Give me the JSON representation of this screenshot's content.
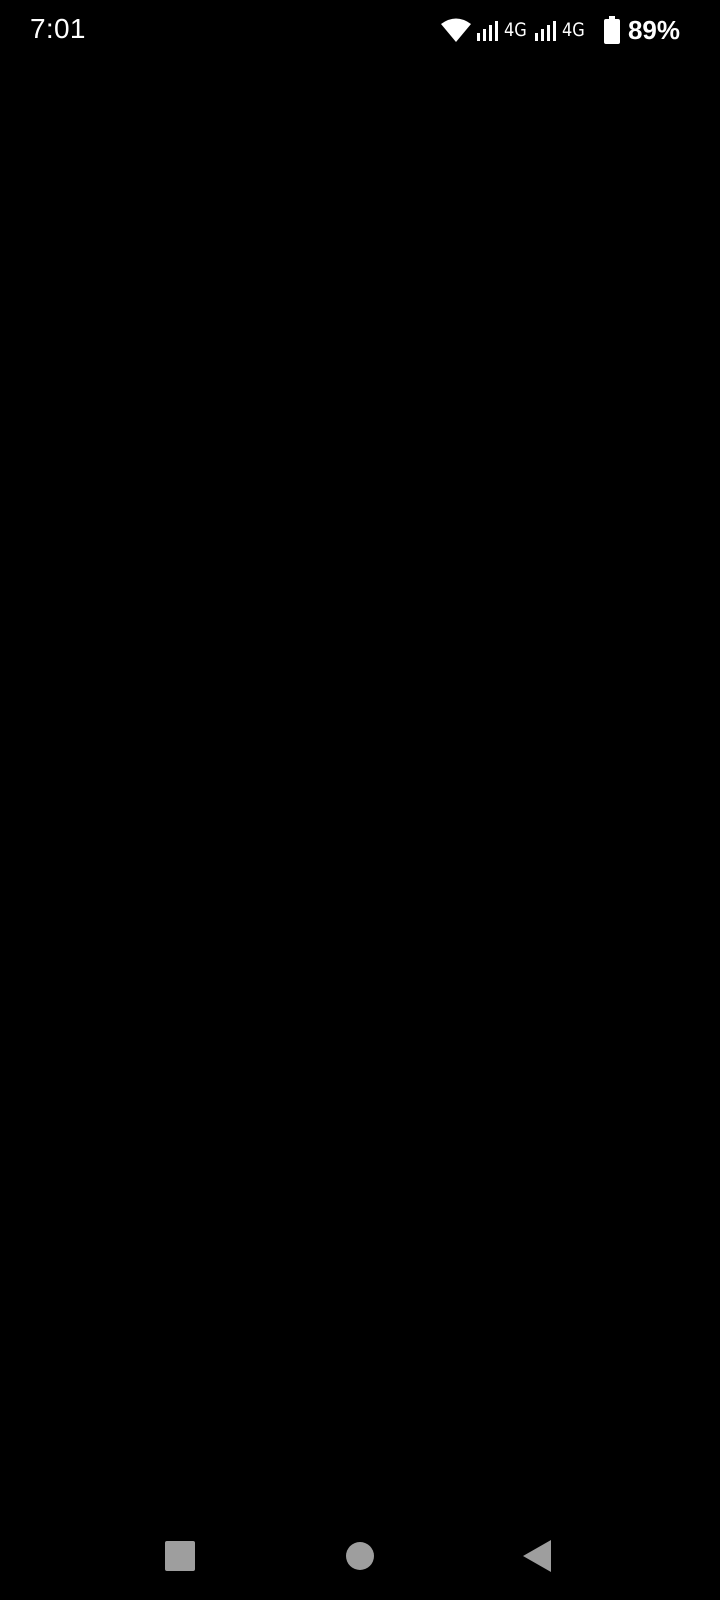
{
  "status_bar": {
    "time": "7:01",
    "wifi_icon": "wifi-icon",
    "sim1": {
      "icon": "cell-signal-icon",
      "network": "4G"
    },
    "sim2": {
      "icon": "cell-signal-icon",
      "network": "4G"
    },
    "battery_icon": "battery-icon",
    "battery_percent": "89%"
  },
  "main": {
    "background": "#000000"
  },
  "navigation_bar": {
    "recents_icon": "square-recents-icon",
    "home_icon": "circle-home-icon",
    "back_icon": "triangle-back-icon",
    "icon_color": "#9e9e9e"
  }
}
